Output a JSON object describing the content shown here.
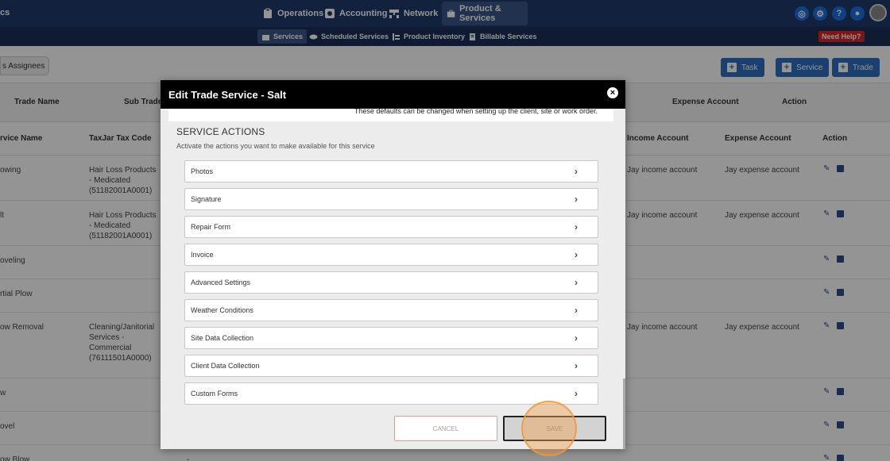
{
  "topnav": {
    "brand_fragment": "cs",
    "items": [
      {
        "label": "Operations",
        "icon": "clipboard-icon"
      },
      {
        "label": "Accounting",
        "icon": "calculator-icon"
      },
      {
        "label": "Network",
        "icon": "network-icon"
      },
      {
        "label": "Product & Services",
        "icon": "briefcase-icon",
        "active": true
      }
    ],
    "right_icons": [
      "target-icon",
      "gear-icon",
      "help-icon",
      "chat-icon",
      "avatar"
    ],
    "help_glyph": "?",
    "accent": "#1e6fe0"
  },
  "subnav": {
    "items": [
      {
        "label": "Services",
        "icon": "briefcase-icon",
        "active": true
      },
      {
        "label": "Scheduled Services",
        "icon": "handshake-icon"
      },
      {
        "label": "Product Inventory",
        "icon": "inventory-icon"
      },
      {
        "label": "Billable Services",
        "icon": "document-icon"
      }
    ],
    "need_help": "Need Help?"
  },
  "page": {
    "assignees_tab": "s Assignees",
    "toolbar": [
      {
        "label": "Task"
      },
      {
        "label": "Service"
      },
      {
        "label": "Trade"
      }
    ],
    "trade_headers": [
      "Trade Name",
      "Sub Trades",
      "Expense Account",
      "Action"
    ],
    "service_headers": [
      "rvice Name",
      "TaxJar Tax Code",
      "Income Account",
      "Expense Account",
      "Action"
    ],
    "rows": [
      {
        "name": "owing",
        "tax": "Hair Loss Products - Medicated (51182001A0001)",
        "income": "Jay income account",
        "expense": "Jay expense account"
      },
      {
        "name": "lt",
        "tax": "Hair Loss Products - Medicated (51182001A0001)",
        "income": "Jay income account",
        "expense": "Jay expense account"
      },
      {
        "name": "oveling",
        "tax": "",
        "income": "",
        "expense": ""
      },
      {
        "name": "rtial Plow",
        "tax": "",
        "income": "",
        "expense": ""
      },
      {
        "name": "ow Removal",
        "tax": "Cleaning/Janitorial Services - Commercial (76111501A0000)",
        "income": "Jay income account",
        "expense": "Jay expense account"
      },
      {
        "name": "w",
        "tax": "",
        "income": "",
        "expense": ""
      },
      {
        "name": "ovel",
        "tax": "",
        "income": "",
        "expense": ""
      },
      {
        "name": "ow Blow",
        "tax": "-",
        "income": "",
        "expense": ""
      }
    ]
  },
  "modal": {
    "title": "Edit Trade Service - Salt",
    "close_glyph": "×",
    "defaults_note": "These defaults can be changed when setting up the client, site or work order.",
    "section_title": "SERVICE ACTIONS",
    "section_subtitle": "Activate the actions you want to make available for this service",
    "actions": [
      "Photos",
      "Signature",
      "Repair Form",
      "Invoice",
      "Advanced Settings",
      "Weather Conditions",
      "Site Data Collection",
      "Client Data Collection",
      "Custom Forms"
    ],
    "cancel_label": "CANCEL",
    "save_label": "SAVE"
  }
}
